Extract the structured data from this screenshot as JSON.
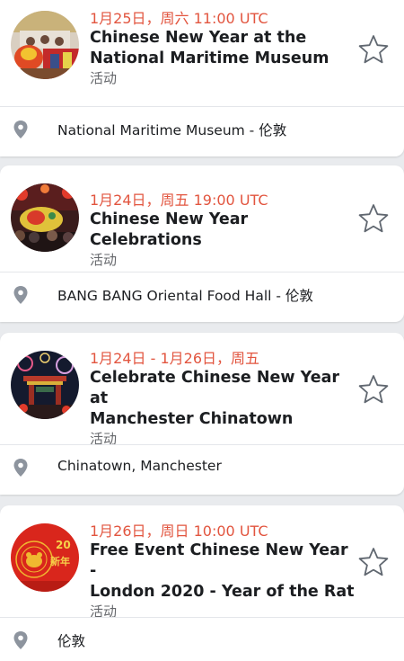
{
  "events": [
    {
      "date": "1月25日，周六 11:00 UTC",
      "title_line1": "Chinese New Year at the",
      "title_line2": "National Maritime Museum",
      "kind": "活动",
      "location": "National Maritime Museum - 伦敦",
      "thumb_icon": "lion-dance-photo"
    },
    {
      "date": "1月24日，周五 19:00 UTC",
      "title_line1": "Chinese New Year Celebrations",
      "title_line2": "",
      "kind": "活动",
      "location": "BANG BANG Oriental Food Hall - 伦敦",
      "thumb_icon": "dragon-crowd-photo"
    },
    {
      "date": "1月24日 - 1月26日，周五",
      "title_line1": "Celebrate Chinese New Year at",
      "title_line2": "Manchester Chinatown",
      "kind": "活动",
      "location": "Chinatown, Manchester",
      "thumb_icon": "chinatown-arch-fireworks-photo"
    },
    {
      "date": "1月26日，周日 10:00 UTC",
      "title_line1": "Free Event Chinese New Year -",
      "title_line2": "London 2020 - Year of the Rat",
      "kind": "活动",
      "location": "伦敦",
      "thumb_icon": "year-of-rat-poster",
      "thumb_text": "新年"
    }
  ],
  "colors": {
    "date": "#e2553f",
    "background": "#e9ebee",
    "card": "#ffffff",
    "icon": "#8d949e"
  },
  "icons": {
    "star": "star-outline-icon",
    "location": "map-pin-icon"
  }
}
